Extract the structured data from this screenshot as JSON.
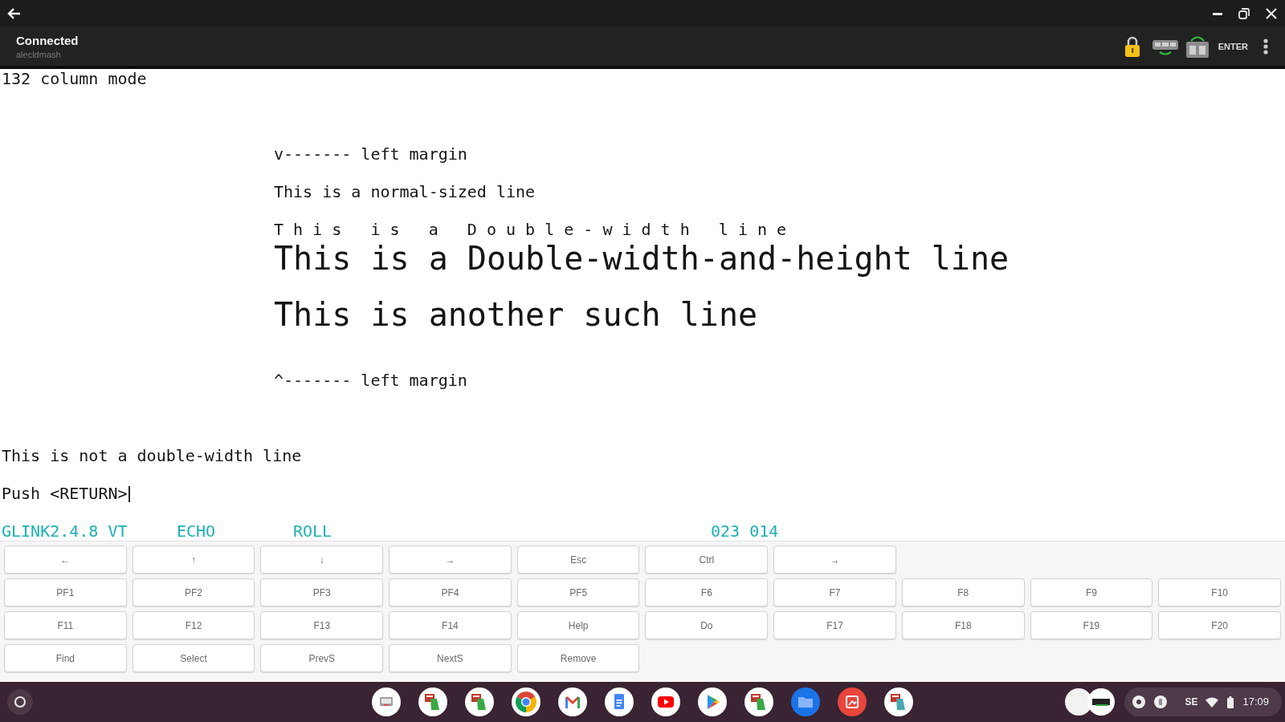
{
  "app_bar": {
    "title": "Connected",
    "subtitle": "alecldmash",
    "enter_label": "ENTER"
  },
  "terminal": {
    "lines": [
      {
        "kind": "text",
        "text": "132 column mode",
        "cursor": false
      },
      {
        "kind": "blank"
      },
      {
        "kind": "blank"
      },
      {
        "kind": "blank"
      },
      {
        "kind": "block",
        "children": [
          {
            "kind": "text",
            "text": "v------- left margin",
            "cursor": false
          },
          {
            "kind": "blank"
          },
          {
            "kind": "text",
            "text": "This is a normal-sized line",
            "cursor": false
          },
          {
            "kind": "blank"
          },
          {
            "kind": "double_width",
            "text": "This is a Double-width line",
            "cursor": false
          },
          {
            "kind": "double_height",
            "text": "This is a Double-width-and-height line",
            "cursor": false
          },
          {
            "kind": "blank"
          },
          {
            "kind": "double_height",
            "text": "This is another such line",
            "cursor": false
          },
          {
            "kind": "blank"
          },
          {
            "kind": "blank"
          },
          {
            "kind": "text",
            "text": "^------- left margin",
            "cursor": false
          }
        ]
      },
      {
        "kind": "blank"
      },
      {
        "kind": "blank"
      },
      {
        "kind": "blank"
      },
      {
        "kind": "text",
        "text": "This is not a double-width line",
        "cursor": false
      },
      {
        "kind": "blank"
      },
      {
        "kind": "text",
        "text": "Push <RETURN>",
        "cursor": true
      }
    ],
    "status_line": {
      "program": "GLINK2.4.8 VT",
      "echo": "ECHO",
      "scroll": "ROLL",
      "position": "023 014"
    }
  },
  "keypad": {
    "rows": [
      [
        "←",
        "↑",
        "↓",
        "→",
        "Esc",
        "Ctrl",
        "→"
      ],
      [
        "PF1",
        "PF2",
        "PF3",
        "PF4",
        "PF5",
        "F6",
        "F7",
        "F8",
        "F9",
        "F10"
      ],
      [
        "F11",
        "F12",
        "F13",
        "F14",
        "Help",
        "Do",
        "F17",
        "F18",
        "F19",
        "F20"
      ],
      [
        "Find",
        "Select",
        "PrevS",
        "NextS",
        "Remove"
      ]
    ]
  },
  "taskbar": {
    "keyboard_layout": "SE",
    "time": "17:09"
  }
}
